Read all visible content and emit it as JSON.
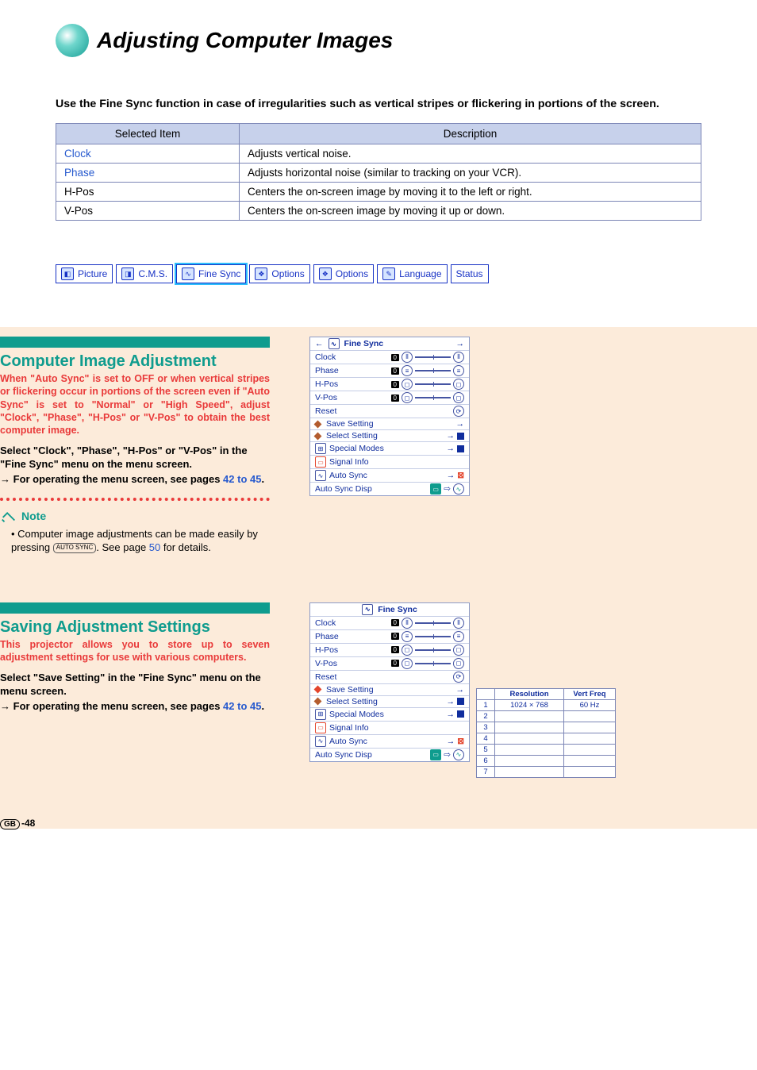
{
  "title": "Adjusting Computer Images",
  "intro": "Use the Fine Sync function in case of irregularities such as vertical stripes or flickering in portions of the screen.",
  "table": {
    "headers": [
      "Selected Item",
      "Description"
    ],
    "rows": [
      {
        "item": "Clock",
        "link": true,
        "desc": "Adjusts vertical noise."
      },
      {
        "item": "Phase",
        "link": true,
        "desc": "Adjusts horizontal noise (similar to tracking on your VCR)."
      },
      {
        "item": "H-Pos",
        "link": false,
        "desc": "Centers the on-screen image by moving it to the left or right."
      },
      {
        "item": "V-Pos",
        "link": false,
        "desc": "Centers the on-screen image by moving it up or down."
      }
    ]
  },
  "menu_tabs": [
    "Picture",
    "C.M.S.",
    "Fine Sync",
    "Options",
    "Options",
    "Language",
    "Status"
  ],
  "menu_selected": "Fine Sync",
  "section1": {
    "heading": "Computer Image Adjustment",
    "lead": "When \"Auto Sync\" is set to OFF or when vertical stripes or flickering occur in portions of the screen even if \"Auto Sync\" is set to \"Normal\" or \"High Speed\", adjust \"Clock\", \"Phase\", \"H-Pos\" or \"V-Pos\" to obtain the best computer image.",
    "body1": "Select \"Clock\", \"Phase\", \"H-Pos\" or \"V-Pos\" in the \"Fine Sync\" menu  on the menu screen.",
    "body2": "For operating the menu screen, see pages ",
    "body2_pages": "42 to 45",
    "note_label": "Note",
    "note_text_a": "Computer image adjustments can be made easily by pressing ",
    "note_btn": "AUTO SYNC",
    "note_text_b": ". See page ",
    "note_page": "50",
    "note_text_c": " for details."
  },
  "section2": {
    "heading": "Saving Adjustment Settings",
    "lead": "This projector allows you to store up to seven adjustment settings for use with various computers.",
    "body1": "Select \"Save Setting\" in the \"Fine Sync\" menu on the menu screen.",
    "body2": "For operating the menu screen, see pages ",
    "body2_pages": "42 to 45"
  },
  "osd": {
    "title": "Fine Sync",
    "rows": [
      "Clock",
      "Phase",
      "H-Pos",
      "V-Pos"
    ],
    "reset": "Reset",
    "items": [
      "Save Setting",
      "Select Setting",
      "Special Modes",
      "Signal Info",
      "Auto Sync",
      "Auto Sync Disp"
    ]
  },
  "save_table": {
    "headers": [
      "",
      "Resolution",
      "Vert Freq"
    ],
    "rows": [
      [
        "1",
        "1024 × 768",
        "60 Hz"
      ],
      [
        "2",
        "",
        ""
      ],
      [
        "3",
        "",
        ""
      ],
      [
        "4",
        "",
        ""
      ],
      [
        "5",
        "",
        ""
      ],
      [
        "6",
        "",
        ""
      ],
      [
        "7",
        "",
        ""
      ]
    ]
  },
  "page_num_prefix": "GB",
  "page_num": "-48"
}
